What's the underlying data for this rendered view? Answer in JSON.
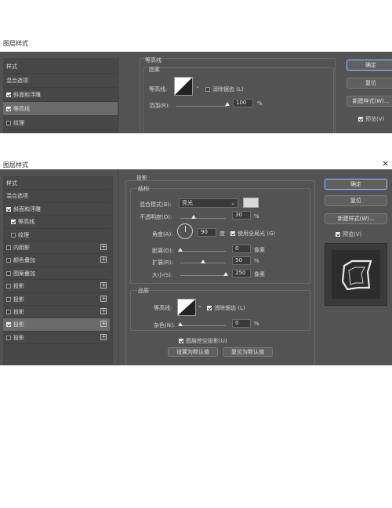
{
  "top": {
    "window_title": "图层样式",
    "sidebar": [
      {
        "label": "样式",
        "checkbox": null,
        "selected": false
      },
      {
        "label": "混合选项",
        "checkbox": null,
        "selected": false
      },
      {
        "label": "斜面和浮雕",
        "checkbox": true,
        "selected": false
      },
      {
        "label": "等高线",
        "checkbox": true,
        "selected": true
      },
      {
        "label": "纹理",
        "checkbox": false,
        "selected": false
      }
    ],
    "section_title": "等高线",
    "group_title": "图素",
    "contour_label": "等高线:",
    "antialias_label": "消除锯齿 (L)",
    "range_label": "范围(R):",
    "range_value": "100",
    "range_unit": "%",
    "range_level": 1.0,
    "buttons": {
      "ok": "确定",
      "reset": "复位",
      "new_style": "新建样式(W)...",
      "preview": "预览(V)"
    }
  },
  "bottom": {
    "window_title": "图层样式",
    "close_glyph": "×",
    "sidebar": [
      {
        "label": "样式",
        "checkbox": null,
        "plus": false,
        "selected": false
      },
      {
        "label": "混合选项",
        "checkbox": null,
        "plus": false,
        "selected": false
      },
      {
        "label": "斜面和浮雕",
        "checkbox": true,
        "plus": false,
        "selected": false
      },
      {
        "label": "等高线",
        "checkbox": true,
        "plus": false,
        "selected": false,
        "indent": true
      },
      {
        "label": "纹理",
        "checkbox": false,
        "plus": false,
        "selected": false,
        "indent": true
      },
      {
        "label": "内阴影",
        "checkbox": false,
        "plus": true,
        "selected": false
      },
      {
        "label": "颜色叠加",
        "checkbox": false,
        "plus": true,
        "selected": false
      },
      {
        "label": "图案叠加",
        "checkbox": false,
        "plus": false,
        "selected": false
      },
      {
        "label": "投影",
        "checkbox": false,
        "plus": true,
        "selected": false
      },
      {
        "label": "投影",
        "checkbox": false,
        "plus": true,
        "selected": false
      },
      {
        "label": "投影",
        "checkbox": false,
        "plus": true,
        "selected": false
      },
      {
        "label": "投影",
        "checkbox": true,
        "plus": true,
        "selected": true
      },
      {
        "label": "投影",
        "checkbox": false,
        "plus": true,
        "selected": false
      }
    ],
    "section_title": "投影",
    "structure_title": "结构",
    "blend_mode_label": "混合模式(B):",
    "blend_mode_value": "亮光",
    "opacity_label": "不透明度(O):",
    "opacity_value": "30",
    "opacity_level": 0.3,
    "percent": "%",
    "angle_label": "角度(A):",
    "angle_value": "90",
    "angle_unit": "度",
    "global_light_label": "使用全局光 (G)",
    "distance_label": "距离(D):",
    "distance_value": "0",
    "distance_unit": "像素",
    "distance_level": 0.0,
    "spread_label": "扩展(R):",
    "spread_value": "50",
    "spread_unit": "%",
    "spread_level": 0.5,
    "size_label": "大小(S):",
    "size_value": "250",
    "size_unit": "像素",
    "size_level": 1.0,
    "quality_title": "品质",
    "contour_label": "等高线:",
    "antialias_label": "消除锯齿 (L)",
    "noise_label": "杂色(N):",
    "noise_value": "0",
    "noise_unit": "%",
    "noise_level": 0.0,
    "knockout_label": "图层挖空投影(U)",
    "set_default": "设置为默认值",
    "reset_default": "复位为默认值",
    "buttons": {
      "ok": "确定",
      "reset": "复位",
      "new_style": "新建样式(W)...",
      "preview": "预览(V)"
    },
    "colors": {
      "shadow_swatch": "#d9d9d9"
    }
  }
}
